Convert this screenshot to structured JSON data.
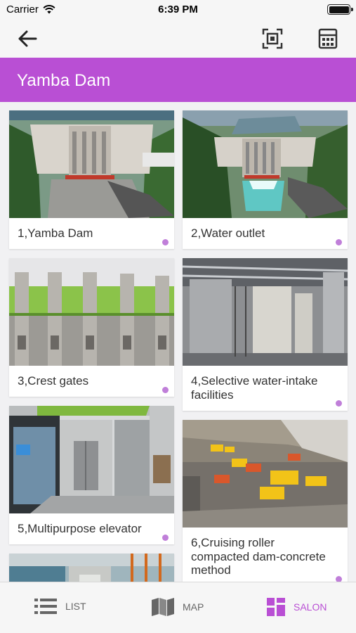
{
  "status_bar": {
    "carrier": "Carrier",
    "time": "6:39 PM"
  },
  "nav": {
    "back_icon": "arrow-left-icon",
    "scan_icon": "qr-scan-icon",
    "calculator_icon": "calculator-icon"
  },
  "header": {
    "title": "Yamba Dam"
  },
  "cards": [
    {
      "label": "1,Yamba Dam",
      "photo": "dam-aerial-photo"
    },
    {
      "label": "2,Water outlet",
      "photo": "water-outlet-photo"
    },
    {
      "label": "3,Crest gates",
      "photo": "crest-gates-photo"
    },
    {
      "label": "4,Selective water-intake facilities",
      "photo": "intake-facility-photo"
    },
    {
      "label": "5,Multipurpose elevator",
      "photo": "elevator-photo"
    },
    {
      "label": "6,Cruising roller compacted dam-concrete method",
      "photo": "construction-site-photo"
    },
    {
      "label": "",
      "photo": "building-interior-photo"
    }
  ],
  "tabs": [
    {
      "label": "LIST",
      "icon": "list-icon"
    },
    {
      "label": "MAP",
      "icon": "map-icon"
    },
    {
      "label": "SALON",
      "icon": "grid-icon"
    }
  ],
  "colors": {
    "accent": "#b94fd4",
    "dot": "#c07fd9"
  }
}
